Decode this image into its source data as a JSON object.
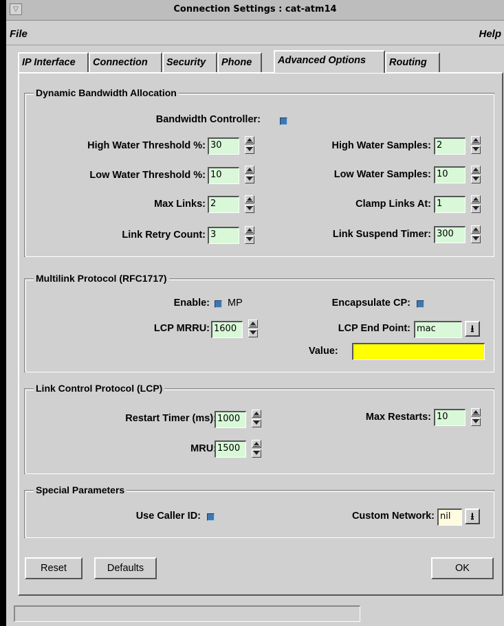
{
  "window": {
    "title": "Connection Settings : cat-atm14"
  },
  "menu": {
    "file": "File",
    "help": "Help"
  },
  "tabs": [
    {
      "label": "IP Interface",
      "active": false
    },
    {
      "label": "Connection",
      "active": false
    },
    {
      "label": "Security",
      "active": false
    },
    {
      "label": "Phone",
      "active": false
    },
    {
      "label": "Advanced Options",
      "active": true
    },
    {
      "label": "Routing",
      "active": false
    }
  ],
  "dba": {
    "title": "Dynamic Bandwidth Allocation",
    "bandwidth_controller_label": "Bandwidth Controller:",
    "bandwidth_controller_checked": true,
    "high_water_threshold_label": "High Water Threshold %:",
    "high_water_threshold": "30",
    "high_water_samples_label": "High Water Samples:",
    "high_water_samples": "2",
    "low_water_threshold_label": "Low Water Threshold %:",
    "low_water_threshold": "10",
    "low_water_samples_label": "Low Water Samples:",
    "low_water_samples": "10",
    "max_links_label": "Max Links:",
    "max_links": "2",
    "clamp_links_label": "Clamp Links At:",
    "clamp_links": "1",
    "link_retry_label": "Link Retry Count:",
    "link_retry": "3",
    "link_suspend_label": "Link Suspend Timer:",
    "link_suspend": "300"
  },
  "mlp": {
    "title": "Multilink Protocol (RFC1717)",
    "enable_label": "Enable:",
    "enable_checked": true,
    "enable_text": "MP",
    "encapsulate_label": "Encapsulate CP:",
    "encapsulate_checked": true,
    "mrru_label": "LCP MRRU:",
    "mrru": "1600",
    "endpoint_label": "LCP End Point:",
    "endpoint": "mac",
    "value_label": "Value:",
    "value": ""
  },
  "lcp": {
    "title": "Link Control Protocol (LCP)",
    "restart_timer_label": "Restart Timer (ms):",
    "restart_timer": "1000",
    "max_restarts_label": "Max Restarts:",
    "max_restarts": "10",
    "mru_label": "MRU:",
    "mru": "1500"
  },
  "special": {
    "title": "Special Parameters",
    "caller_id_label": "Use Caller ID:",
    "caller_id_checked": true,
    "custom_network_label": "Custom Network:",
    "custom_network": "nil"
  },
  "buttons": {
    "reset": "Reset",
    "defaults": "Defaults",
    "ok": "OK"
  },
  "icons": {
    "window_menu": "window-menu-icon",
    "spin": "spin-arrows-icon",
    "dropdown": "dropdown-arrow-icon"
  },
  "colors": {
    "background": "#d0d0d0",
    "field": "#d8f8d8",
    "checkbox": "#3f78b0",
    "value_field": "#ffff00"
  }
}
